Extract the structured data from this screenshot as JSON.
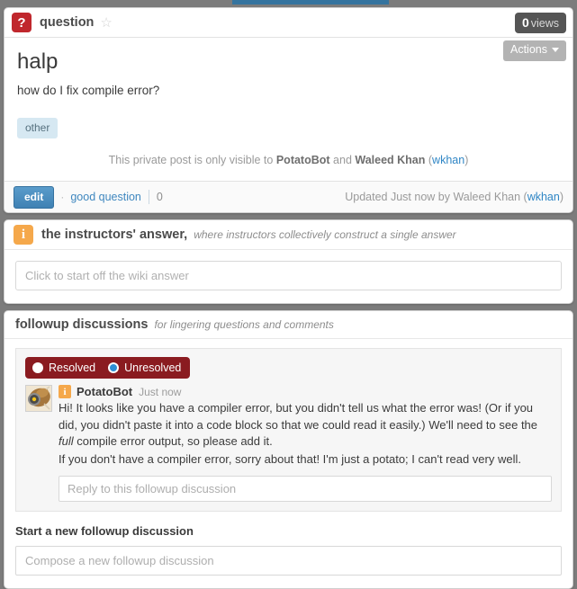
{
  "topbar": {
    "progress_color": "#35749f"
  },
  "question": {
    "type_icon": "question-mark-icon",
    "type_label": "question",
    "star_icon": "star-outline-icon",
    "views_count": "0",
    "views_label": "views",
    "actions_label": "Actions",
    "subject": "halp",
    "content": "how do I fix compile error?",
    "tags": [
      "other"
    ],
    "privacy_prefix": "This private post is only visible to ",
    "privacy_user1": "PotatoBot",
    "privacy_joiner": " and ",
    "privacy_user2": "Waleed Khan",
    "privacy_open": " (",
    "privacy_handle": "wkhan",
    "privacy_close": ")",
    "edit_label": "edit",
    "dot_separator": "·",
    "good_question_label": "good question",
    "good_question_count": "0",
    "updated_prefix": "Updated Just now by Waleed Khan (",
    "updated_handle": "wkhan",
    "updated_close": ")"
  },
  "instructors_answer": {
    "icon": "info-icon",
    "title": "the instructors' answer,",
    "subtitle": "where instructors collectively construct a single answer",
    "wiki_placeholder": "Click to start off the wiki answer"
  },
  "followup": {
    "title": "followup discussions",
    "subtitle": "for lingering questions and comments",
    "resolve_toggle": {
      "resolved_label": "Resolved",
      "resolved_selected": false,
      "unresolved_label": "Unresolved",
      "unresolved_selected": true
    },
    "discussion": {
      "avatar": "potato-avatar",
      "author_badge": "info-icon",
      "author": "PotatoBot",
      "time": "Just now",
      "para1_a": "Hi! It looks like you have a compiler error, but you didn't tell us what the error was! (Or if you did, you didn't paste it into a code block so that we could read it easily.) We'll need to see the ",
      "para1_em": "full",
      "para1_b": " compile error output, so please add it.",
      "para2": "If you don't have a compiler error, sorry about that! I'm just a potato; I can't read very well.",
      "reply_placeholder": "Reply to this followup discussion"
    },
    "new_discussion_label": "Start a new followup discussion",
    "new_discussion_placeholder": "Compose a new followup discussion"
  },
  "colors": {
    "question_red": "#c0272d",
    "instructor_orange": "#f5a84b",
    "link_blue": "#2f86c5",
    "toggle_dark_red": "#8a1b20",
    "radio_blue": "#2d8fd5",
    "tag_bg": "#d6e8f2",
    "page_bg": "#7c7c7c"
  }
}
